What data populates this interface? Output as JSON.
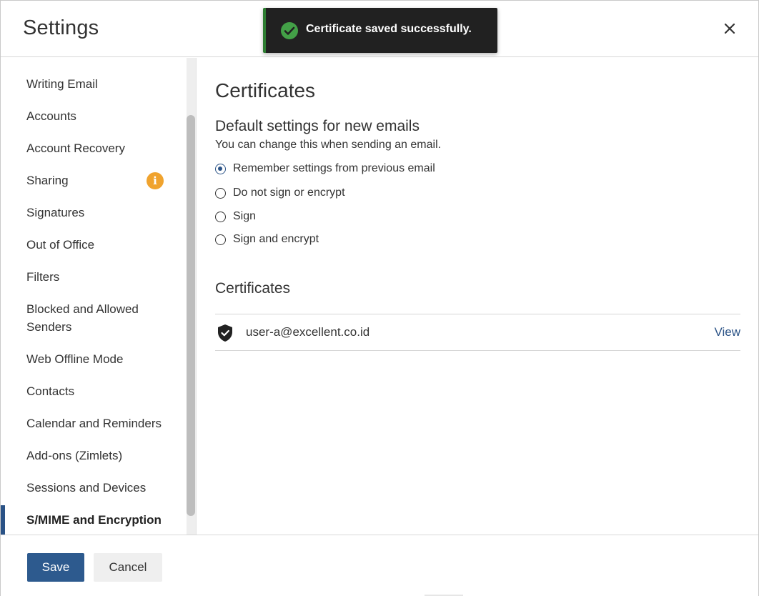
{
  "header": {
    "title": "Settings",
    "close_icon": "close-icon"
  },
  "toast": {
    "message": "Certificate saved successfully.",
    "icon": "check-circle-icon",
    "icon_color": "#2e7d32"
  },
  "sidebar": {
    "items": [
      {
        "label": "Writing Email"
      },
      {
        "label": "Accounts"
      },
      {
        "label": "Account Recovery"
      },
      {
        "label": "Sharing",
        "badge_icon": "info-icon",
        "badge_glyph": "i",
        "badge_color": "#f0a32e"
      },
      {
        "label": "Signatures"
      },
      {
        "label": "Out of Office"
      },
      {
        "label": "Filters"
      },
      {
        "label": "Blocked and Allowed Senders"
      },
      {
        "label": "Web Offline Mode"
      },
      {
        "label": "Contacts"
      },
      {
        "label": "Calendar and Reminders"
      },
      {
        "label": "Add-ons (Zimlets)"
      },
      {
        "label": "Sessions and Devices"
      },
      {
        "label": "S/MIME and Encryption",
        "active": true
      }
    ]
  },
  "main": {
    "title": "Certificates",
    "default_section": {
      "heading": "Default settings for new emails",
      "help": "You can change this when sending an email.",
      "options": [
        {
          "label": "Remember settings from previous email",
          "checked": true
        },
        {
          "label": "Do not sign or encrypt",
          "checked": false
        },
        {
          "label": "Sign",
          "checked": false
        },
        {
          "label": "Sign and encrypt",
          "checked": false
        }
      ]
    },
    "certificates_section": {
      "heading": "Certificates",
      "items": [
        {
          "email": "user-a@excellent.co.id",
          "action": "View",
          "icon": "shield-check-icon"
        }
      ]
    }
  },
  "footer": {
    "save_label": "Save",
    "cancel_label": "Cancel"
  },
  "colors": {
    "accent": "#2a5286",
    "primary_button": "#2d5a8e",
    "toast_bg": "#212121",
    "badge": "#f0a32e"
  }
}
